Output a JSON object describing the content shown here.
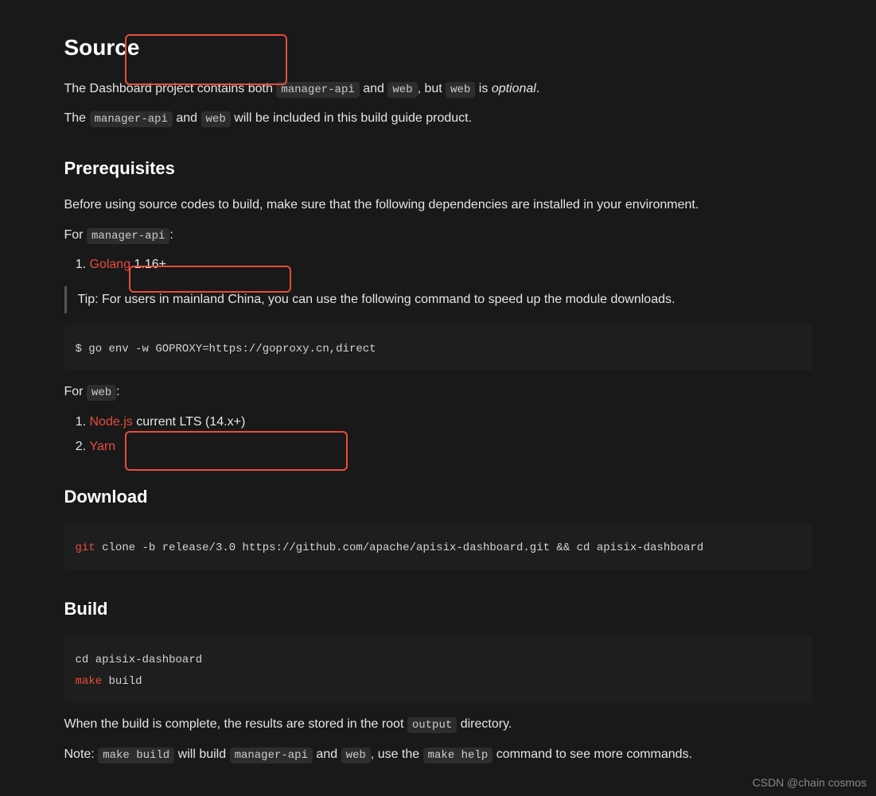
{
  "sections": {
    "source": {
      "title": "Source",
      "p1_part1": "The Dashboard project contains both ",
      "p1_code1": "manager-api",
      "p1_part2": " and ",
      "p1_code2": "web",
      "p1_part3": ", but ",
      "p1_code3": "web",
      "p1_part4": " is ",
      "p1_italic": "optional",
      "p1_part5": ".",
      "p2_part1": "The ",
      "p2_code1": "manager-api",
      "p2_part2": " and ",
      "p2_code2": "web",
      "p2_part3": " will be included in this build guide product."
    },
    "prerequisites": {
      "title": "Prerequisites",
      "intro": "Before using source codes to build, make sure that the following dependencies are installed in your environment.",
      "for_api_part1": "For ",
      "for_api_code": "manager-api",
      "for_api_part2": ":",
      "api_deps": {
        "golang_link": "Golang",
        "golang_version": " 1.16+"
      },
      "tip": "Tip: For users in mainland China, you can use the following command to speed up the module downloads.",
      "goproxy_cmd": "$ go env -w GOPROXY=https://goproxy.cn,direct",
      "for_web_part1": "For ",
      "for_web_code": "web",
      "for_web_part2": ":",
      "web_deps": {
        "nodejs_link": "Node.js",
        "nodejs_version": " current LTS (14.x+)",
        "yarn_link": "Yarn"
      }
    },
    "download": {
      "title": "Download",
      "cmd_git": "git",
      "cmd_rest": " clone -b release/3.0 https://github.com/apache/apisix-dashboard.git && cd apisix-dashboard"
    },
    "build": {
      "title": "Build",
      "cmd_line1": "cd apisix-dashboard",
      "cmd_make": "make",
      "cmd_build": " build",
      "result_part1": "When the build is complete, the results are stored in the root ",
      "result_code": "output",
      "result_part2": " directory.",
      "note_part1": "Note: ",
      "note_code1": "make build",
      "note_part2": " will build ",
      "note_code2": "manager-api",
      "note_part3": " and ",
      "note_code3": "web",
      "note_part4": ", use the ",
      "note_code4": "make help",
      "note_part5": " command to see more commands."
    }
  },
  "watermark": "CSDN @chain cosmos"
}
